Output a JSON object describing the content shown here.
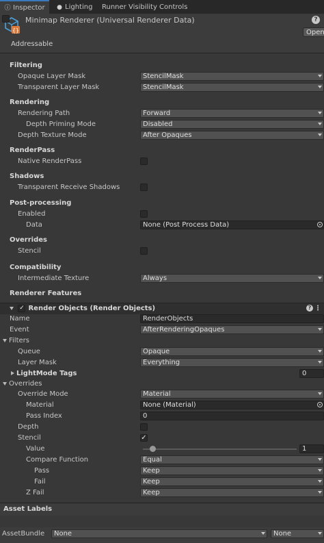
{
  "tabs": [
    {
      "label": "Inspector",
      "icon": "info-icon",
      "active": true
    },
    {
      "label": "Lighting",
      "icon": "lightbulb-icon",
      "active": false
    },
    {
      "label": "Runner Visibility Controls",
      "active": false
    }
  ],
  "header": {
    "title": "Minimap Renderer (Universal Renderer Data)",
    "help_icon": "?",
    "open_label": "Open",
    "addressable_label": "Addressable"
  },
  "sections": {
    "filtering": "Filtering",
    "opaque_mask_label": "Opaque Layer Mask",
    "opaque_mask_value": "StencilMask",
    "transparent_mask_label": "Transparent Layer Mask",
    "transparent_mask_value": "StencilMask",
    "rendering": "Rendering",
    "rendering_path_label": "Rendering Path",
    "rendering_path_value": "Forward",
    "depth_priming_label": "Depth Priming Mode",
    "depth_priming_value": "Disabled",
    "depth_texture_label": "Depth Texture Mode",
    "depth_texture_value": "After Opaques",
    "renderpass": "RenderPass",
    "native_renderpass_label": "Native RenderPass",
    "shadows": "Shadows",
    "transparent_shadows_label": "Transparent Receive Shadows",
    "postprocessing": "Post-processing",
    "enabled_label": "Enabled",
    "data_label": "Data",
    "data_value": "None (Post Process Data)",
    "overrides": "Overrides",
    "stencil_label": "Stencil",
    "compatibility": "Compatibility",
    "intermediate_label": "Intermediate Texture",
    "intermediate_value": "Always",
    "renderer_features": "Renderer Features"
  },
  "feature": {
    "title": "Render Objects (Render Objects)",
    "name_label": "Name",
    "name_value": "RenderObjects",
    "event_label": "Event",
    "event_value": "AfterRenderingOpaques",
    "filters_label": "Filters",
    "queue_label": "Queue",
    "queue_value": "Opaque",
    "layer_mask_label": "Layer Mask",
    "layer_mask_value": "Everything",
    "lightmode_label": "LightMode Tags",
    "lightmode_value": "0",
    "overrides_label": "Overrides",
    "override_mode_label": "Override Mode",
    "override_mode_value": "Material",
    "material_label": "Material",
    "material_value": "None (Material)",
    "pass_index_label": "Pass Index",
    "pass_index_value": "0",
    "depth_label": "Depth",
    "stencil_label": "Stencil",
    "value_label": "Value",
    "value_value": "1",
    "value_fraction": 0.0,
    "compare_label": "Compare Function",
    "compare_value": "Equal",
    "pass_label": "Pass",
    "pass_value": "Keep",
    "fail_label": "Fail",
    "fail_value": "Keep",
    "zfail_label": "Z Fail",
    "zfail_value": "Keep"
  },
  "footer": {
    "asset_labels": "Asset Labels",
    "assetbundle_label": "AssetBundle",
    "assetbundle_value": "None",
    "variant_value": "None"
  },
  "colors": {
    "background": "#383838",
    "tab_accent": "#3a79bb",
    "icon_blue": "#4aa3df",
    "icon_orange": "#e07a3a"
  }
}
